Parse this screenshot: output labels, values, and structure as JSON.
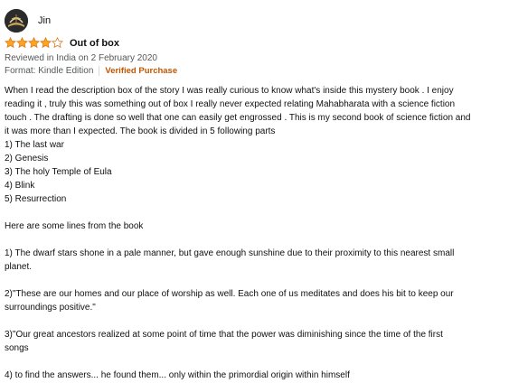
{
  "reviewer": {
    "name": "Jin",
    "avatar_icon": "reviewer-avatar-icon"
  },
  "rating": {
    "stars": 4,
    "max": 5,
    "star_color": "#ffa41c",
    "star_outline": "#de7921"
  },
  "review": {
    "title": "Out of box",
    "date": "Reviewed in India on 2 February 2020",
    "format": "Format: Kindle Edition",
    "verified": "Verified Purchase",
    "body_lines": [
      "When I read the description box of the story I was really curious to know what's inside this mystery book . I enjoy",
      "reading it , truly this was something out of box I really never expected relating Mahabharata with a science fiction",
      "touch . The drafting is done so well that one can easily get engrossed . This is my second book of science fiction and",
      "it was more than I expected. The book is divided in 5 following parts",
      "1) The last war",
      "2) Genesis",
      "3) The holy Temple of Eula",
      "4) Blink",
      "5) Resurrection",
      "",
      "Here are some lines from the book",
      "",
      "1) The dwarf stars shone in a pale manner, but gave enough sunshine due to their proximity to this nearest small",
      "planet.",
      "",
      "2)\"These are our homes and our place of worship as well. Each one of us meditates and does his bit to keep our",
      "surroundings positive.\"",
      "",
      "3)\"Our great ancestors realized at some point of time that the power was diminishing since the time of the first",
      "songs",
      "",
      "4) to find the answers... he found them... only within the primordial origin within himself"
    ]
  }
}
